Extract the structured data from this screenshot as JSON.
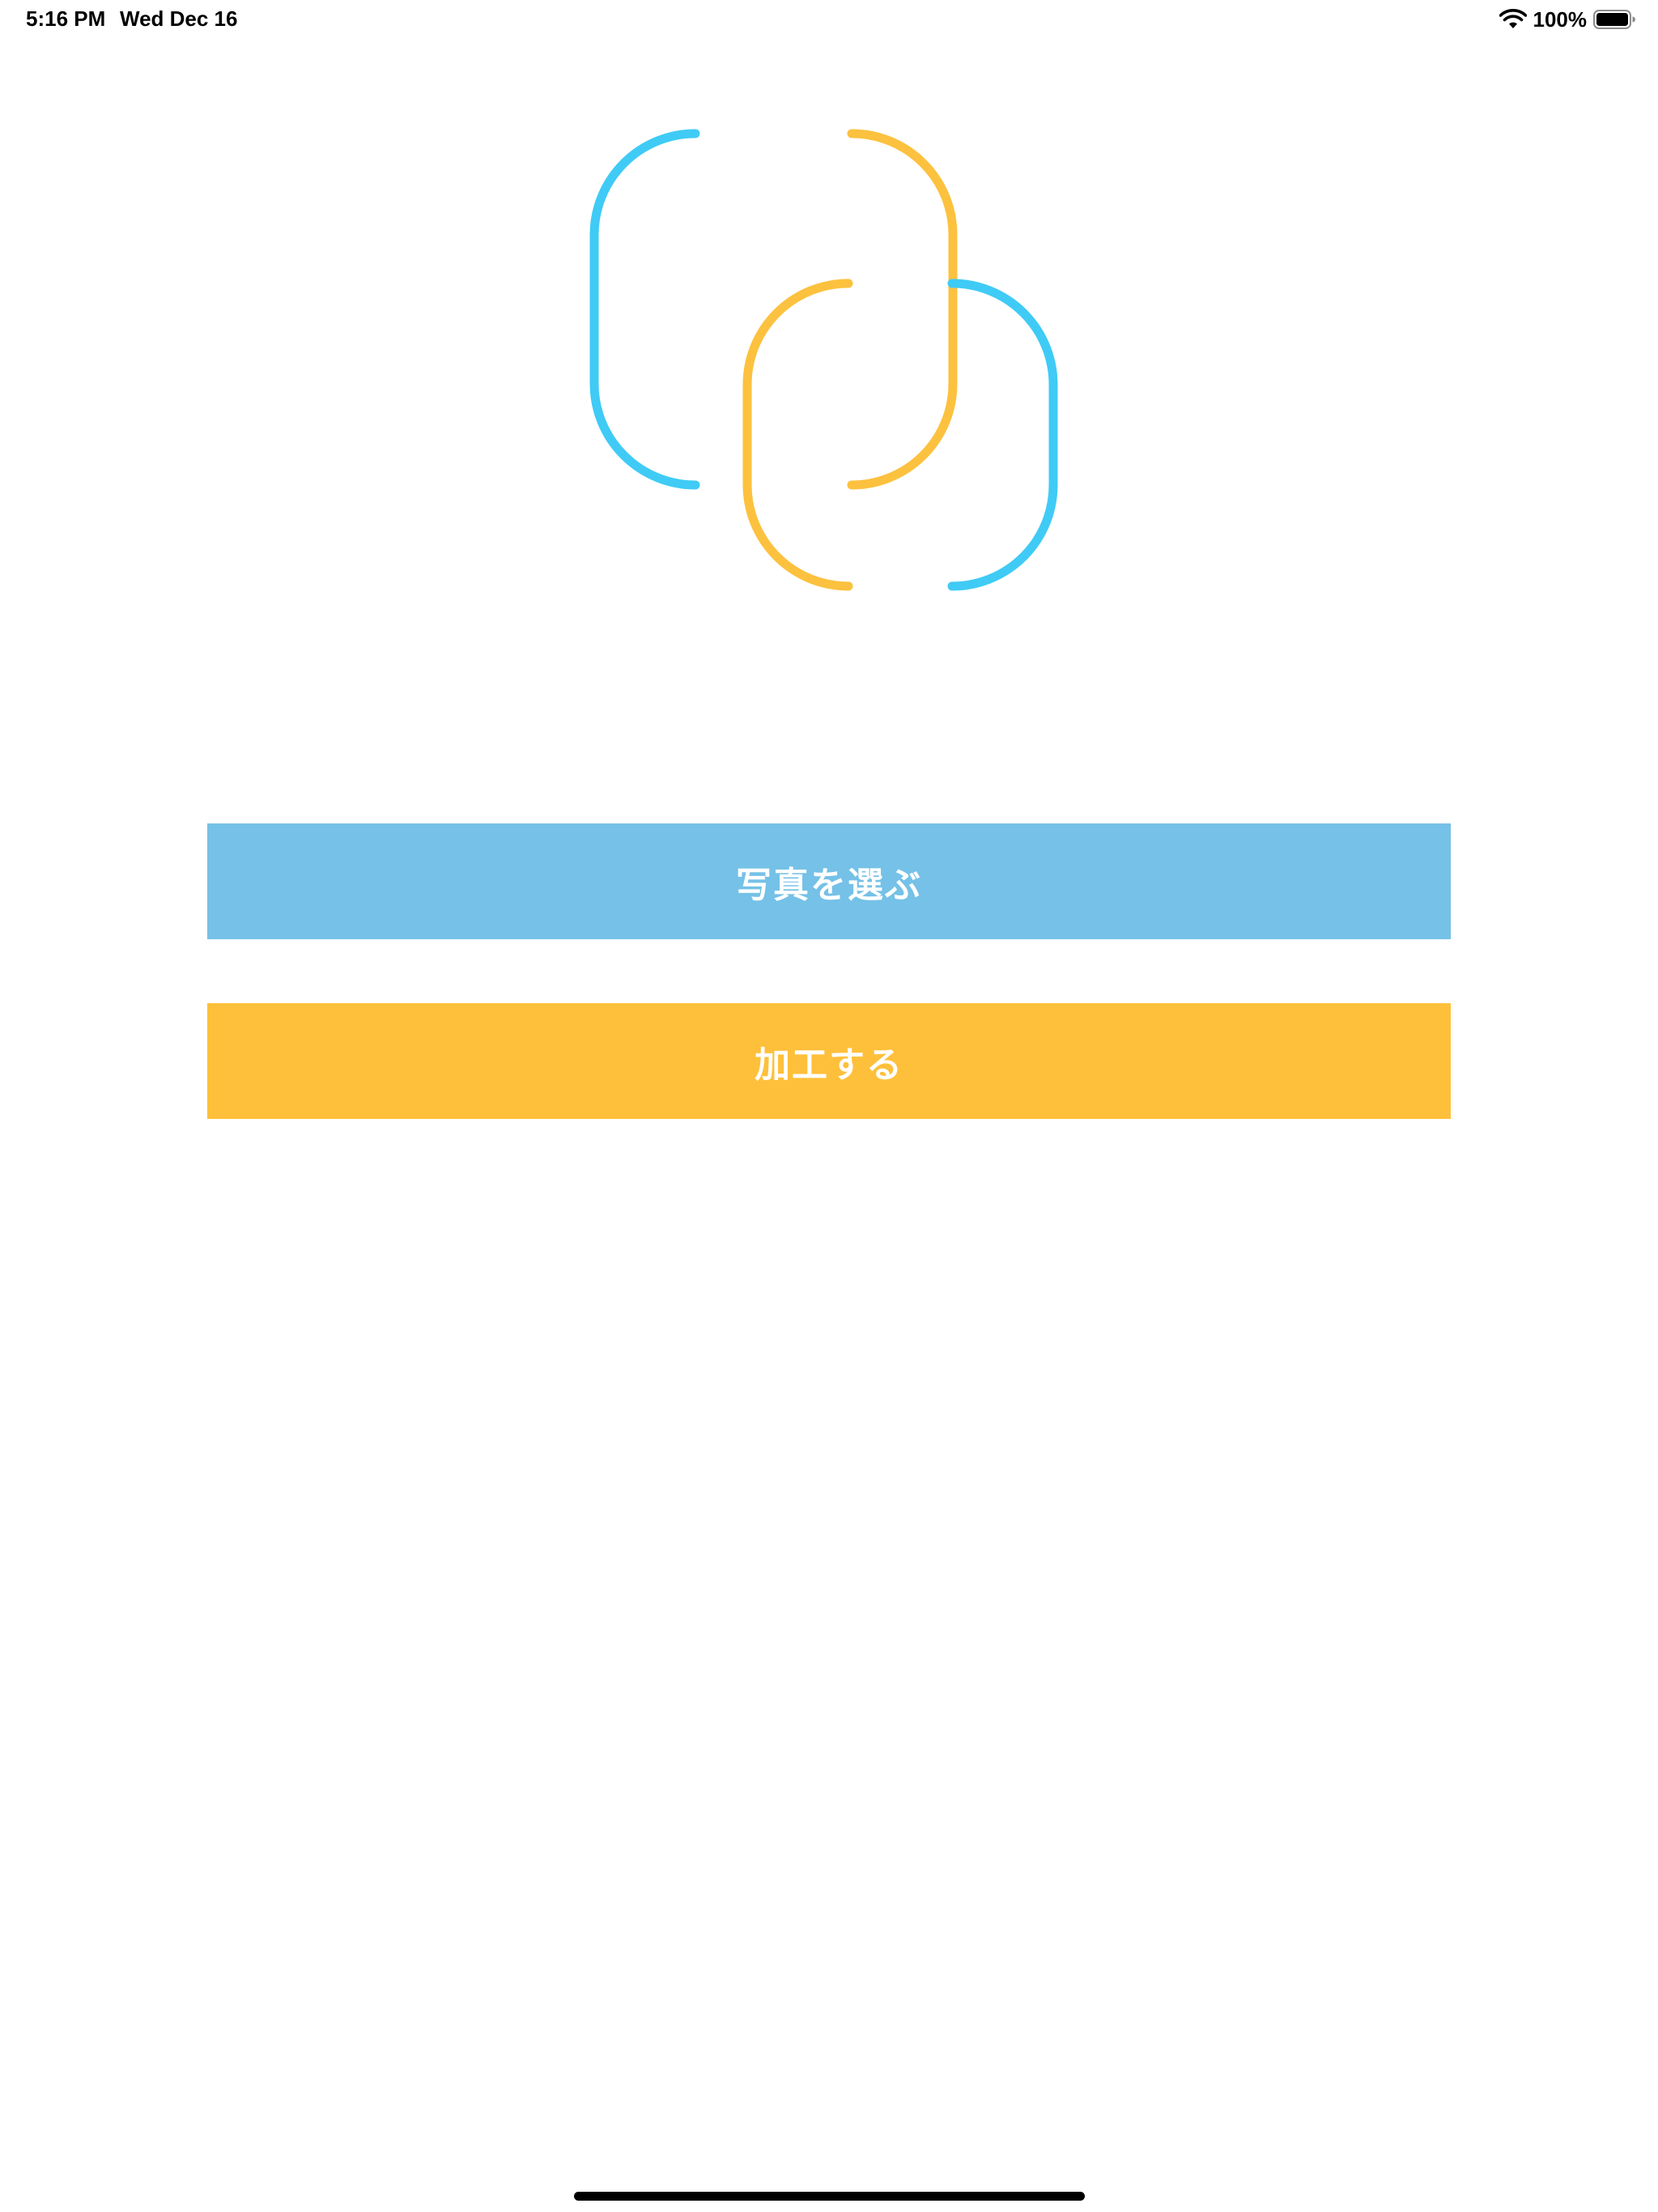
{
  "status_bar": {
    "time": "5:16 PM",
    "date": "Wed Dec 16",
    "battery_percent": "100%",
    "wifi_icon": "wifi-icon",
    "battery_icon": "battery-full-icon"
  },
  "logo": {
    "icon": "overlapping-rounded-squares-logo",
    "colors": {
      "blue": "#3FCBF5",
      "cyan": "#8CF3FB",
      "yellow": "#FCC13E"
    }
  },
  "buttons": {
    "choose_photo_label": "写真を選ぶ",
    "choose_photo_color": "#75C1E7",
    "process_label": "加工する",
    "process_color": "#FEC03B"
  }
}
